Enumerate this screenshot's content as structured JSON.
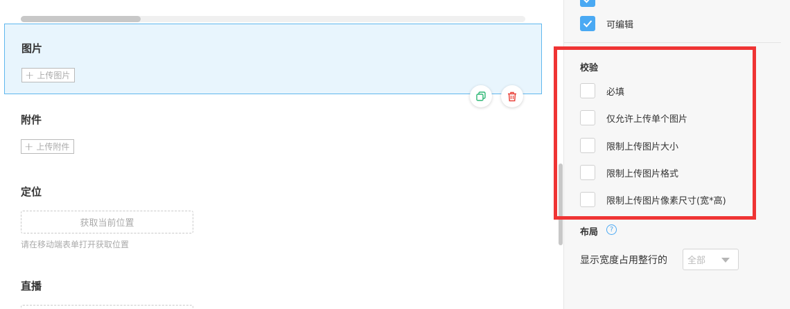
{
  "form": {
    "image_field": {
      "label": "图片",
      "upload_label": "上传图片"
    },
    "attachment_field": {
      "label": "附件",
      "upload_label": "上传附件"
    },
    "location_field": {
      "label": "定位",
      "button_label": "获取当前位置",
      "hint": "请在移动端表单打开获取位置"
    },
    "live_field": {
      "label": "直播"
    },
    "icons": {
      "copy": "copy-icon",
      "delete": "trash-icon",
      "plus": "plus-icon"
    }
  },
  "panel": {
    "editable": {
      "label": "可编辑",
      "checked": true
    },
    "validation": {
      "title": "校验",
      "options": [
        {
          "label": "必填",
          "checked": false
        },
        {
          "label": "仅允许上传单个图片",
          "checked": false
        },
        {
          "label": "限制上传图片大小",
          "checked": false
        },
        {
          "label": "限制上传图片格式",
          "checked": false
        },
        {
          "label": "限制上传图片像素尺寸(宽*高)",
          "checked": false
        }
      ]
    },
    "layout": {
      "title": "布局",
      "help_icon": "?",
      "width_label": "显示宽度占用整行的",
      "width_value": "全部"
    }
  },
  "colors": {
    "accent": "#4aa9f3",
    "highlight": "#ef3434",
    "selected_bg": "#e8f5fd",
    "delete": "#e9433b",
    "copy": "#2bb673"
  }
}
